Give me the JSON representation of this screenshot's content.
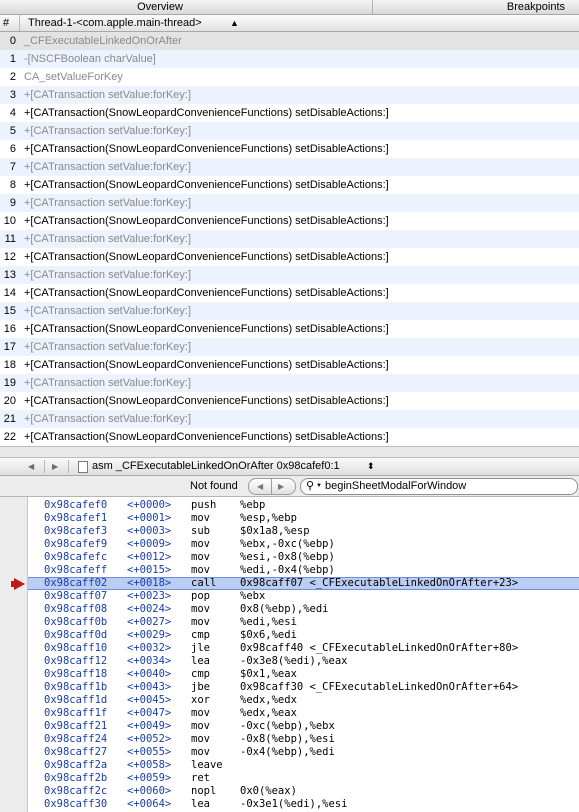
{
  "topbar": {
    "overview": "Overview",
    "breakpoints": "Breakpoints"
  },
  "stack_header": {
    "hash": "#",
    "thread": "Thread-1-<com.apple.main-thread>",
    "updown": "⬍"
  },
  "stack_frames": [
    {
      "num": "0",
      "fn": "_CFExecutableLinkedOnOrAfter",
      "dim": true
    },
    {
      "num": "1",
      "fn": "-[NSCFBoolean charValue]",
      "dim": true
    },
    {
      "num": "2",
      "fn": "CA_setValueForKey",
      "dim": true
    },
    {
      "num": "3",
      "fn": "+[CATransaction setValue:forKey:]",
      "dim": true
    },
    {
      "num": "4",
      "fn": "+[CATransaction(SnowLeopardConvenienceFunctions) setDisableActions:]",
      "dim": false
    },
    {
      "num": "5",
      "fn": "+[CATransaction setValue:forKey:]",
      "dim": true
    },
    {
      "num": "6",
      "fn": "+[CATransaction(SnowLeopardConvenienceFunctions) setDisableActions:]",
      "dim": false
    },
    {
      "num": "7",
      "fn": "+[CATransaction setValue:forKey:]",
      "dim": true
    },
    {
      "num": "8",
      "fn": "+[CATransaction(SnowLeopardConvenienceFunctions) setDisableActions:]",
      "dim": false
    },
    {
      "num": "9",
      "fn": "+[CATransaction setValue:forKey:]",
      "dim": true
    },
    {
      "num": "10",
      "fn": "+[CATransaction(SnowLeopardConvenienceFunctions) setDisableActions:]",
      "dim": false
    },
    {
      "num": "11",
      "fn": "+[CATransaction setValue:forKey:]",
      "dim": true
    },
    {
      "num": "12",
      "fn": "+[CATransaction(SnowLeopardConvenienceFunctions) setDisableActions:]",
      "dim": false
    },
    {
      "num": "13",
      "fn": "+[CATransaction setValue:forKey:]",
      "dim": true
    },
    {
      "num": "14",
      "fn": "+[CATransaction(SnowLeopardConvenienceFunctions) setDisableActions:]",
      "dim": false
    },
    {
      "num": "15",
      "fn": "+[CATransaction setValue:forKey:]",
      "dim": true
    },
    {
      "num": "16",
      "fn": "+[CATransaction(SnowLeopardConvenienceFunctions) setDisableActions:]",
      "dim": false
    },
    {
      "num": "17",
      "fn": "+[CATransaction setValue:forKey:]",
      "dim": true
    },
    {
      "num": "18",
      "fn": "+[CATransaction(SnowLeopardConvenienceFunctions) setDisableActions:]",
      "dim": false
    },
    {
      "num": "19",
      "fn": "+[CATransaction setValue:forKey:]",
      "dim": true
    },
    {
      "num": "20",
      "fn": "+[CATransaction(SnowLeopardConvenienceFunctions) setDisableActions:]",
      "dim": false
    },
    {
      "num": "21",
      "fn": "+[CATransaction setValue:forKey:]",
      "dim": true
    },
    {
      "num": "22",
      "fn": "+[CATransaction(SnowLeopardConvenienceFunctions) setDisableActions:]",
      "dim": false
    }
  ],
  "navbar": {
    "path": "asm _CFExecutableLinkedOnOrAfter  0x98cafef0:1",
    "updown": "⬍"
  },
  "findbar": {
    "status": "Not found",
    "query": "beginSheetModalForWindow"
  },
  "asm": [
    {
      "addr": "0x98cafef0",
      "off": "<+0000>",
      "mn": "push",
      "op": "%ebp"
    },
    {
      "addr": "0x98cafef1",
      "off": "<+0001>",
      "mn": "mov",
      "op": "%esp,%ebp"
    },
    {
      "addr": "0x98cafef3",
      "off": "<+0003>",
      "mn": "sub",
      "op": "$0x1a8,%esp"
    },
    {
      "addr": "0x98cafef9",
      "off": "<+0009>",
      "mn": "mov",
      "op": "%ebx,-0xc(%ebp)"
    },
    {
      "addr": "0x98cafefc",
      "off": "<+0012>",
      "mn": "mov",
      "op": "%esi,-0x8(%ebp)"
    },
    {
      "addr": "0x98cafeff",
      "off": "<+0015>",
      "mn": "mov",
      "op": "%edi,-0x4(%ebp)"
    },
    {
      "addr": "0x98caff02",
      "off": "<+0018>",
      "mn": "call",
      "op": "0x98caff07 <_CFExecutableLinkedOnOrAfter+23>",
      "current": true
    },
    {
      "addr": "0x98caff07",
      "off": "<+0023>",
      "mn": "pop",
      "op": "%ebx"
    },
    {
      "addr": "0x98caff08",
      "off": "<+0024>",
      "mn": "mov",
      "op": "0x8(%ebp),%edi"
    },
    {
      "addr": "0x98caff0b",
      "off": "<+0027>",
      "mn": "mov",
      "op": "%edi,%esi"
    },
    {
      "addr": "0x98caff0d",
      "off": "<+0029>",
      "mn": "cmp",
      "op": "$0x6,%edi"
    },
    {
      "addr": "0x98caff10",
      "off": "<+0032>",
      "mn": "jle",
      "op": "0x98caff40 <_CFExecutableLinkedOnOrAfter+80>"
    },
    {
      "addr": "0x98caff12",
      "off": "<+0034>",
      "mn": "lea",
      "op": "-0x3e8(%edi),%eax"
    },
    {
      "addr": "0x98caff18",
      "off": "<+0040>",
      "mn": "cmp",
      "op": "$0x1,%eax"
    },
    {
      "addr": "0x98caff1b",
      "off": "<+0043>",
      "mn": "jbe",
      "op": "0x98caff30 <_CFExecutableLinkedOnOrAfter+64>"
    },
    {
      "addr": "0x98caff1d",
      "off": "<+0045>",
      "mn": "xor",
      "op": "%edx,%edx"
    },
    {
      "addr": "0x98caff1f",
      "off": "<+0047>",
      "mn": "mov",
      "op": "%edx,%eax"
    },
    {
      "addr": "0x98caff21",
      "off": "<+0049>",
      "mn": "mov",
      "op": "-0xc(%ebp),%ebx"
    },
    {
      "addr": "0x98caff24",
      "off": "<+0052>",
      "mn": "mov",
      "op": "-0x8(%ebp),%esi"
    },
    {
      "addr": "0x98caff27",
      "off": "<+0055>",
      "mn": "mov",
      "op": "-0x4(%ebp),%edi"
    },
    {
      "addr": "0x98caff2a",
      "off": "<+0058>",
      "mn": "leave",
      "op": ""
    },
    {
      "addr": "0x98caff2b",
      "off": "<+0059>",
      "mn": "ret",
      "op": ""
    },
    {
      "addr": "0x98caff2c",
      "off": "<+0060>",
      "mn": "nopl",
      "op": "0x0(%eax)"
    },
    {
      "addr": "0x98caff30",
      "off": "<+0064>",
      "mn": "lea",
      "op": "-0x3e1(%edi),%esi"
    }
  ]
}
